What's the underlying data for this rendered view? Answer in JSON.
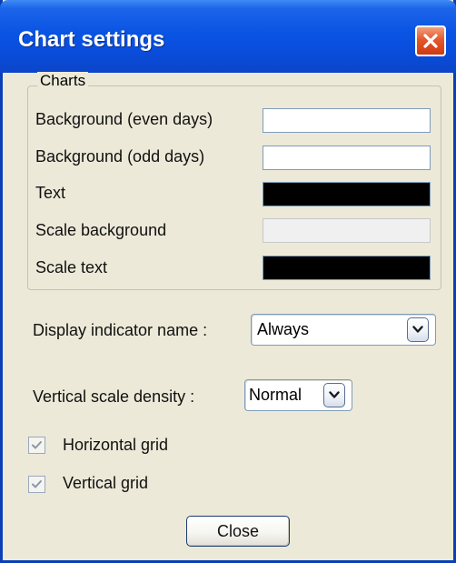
{
  "window": {
    "title": "Chart settings",
    "close_icon": "close-icon"
  },
  "charts_group": {
    "label": "Charts",
    "rows": [
      {
        "label": "Background (even days)",
        "color": "#ffffff"
      },
      {
        "label": "Background (odd days)",
        "color": "#ffffff"
      },
      {
        "label": "Text",
        "color": "#000000"
      },
      {
        "label": "Scale background",
        "color": "#f0f0f0"
      },
      {
        "label": "Scale text",
        "color": "#000000"
      }
    ]
  },
  "display_indicator": {
    "label": "Display indicator name :",
    "value": "Always",
    "icon": "chevron-down-icon"
  },
  "vertical_scale": {
    "label": "Vertical scale density :",
    "value": "Normal",
    "icon": "chevron-down-icon"
  },
  "horizontal_grid": {
    "label": "Horizontal grid",
    "checked": true
  },
  "vertical_grid": {
    "label": "Vertical grid",
    "checked": true
  },
  "close_button": {
    "label": "Close"
  }
}
